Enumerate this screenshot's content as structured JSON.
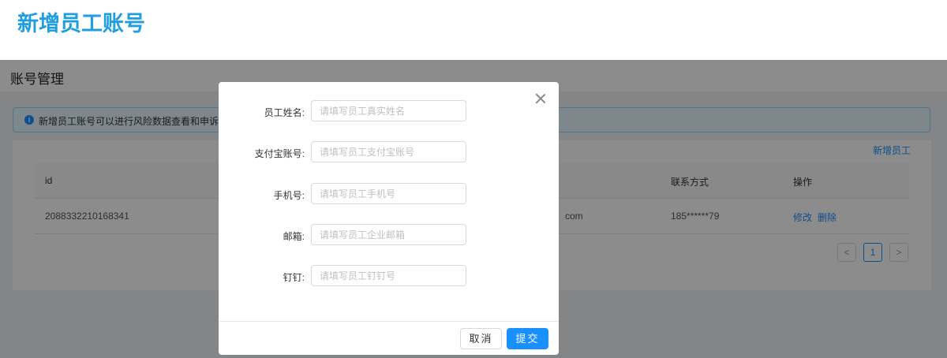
{
  "top_title": "新增员工账号",
  "page": {
    "title": "账号管理",
    "alert_text": "新增员工账号可以进行风险数据查看和申诉操作",
    "add_link": "新增员工",
    "table": {
      "headers": [
        "id",
        "联系方式",
        "操作"
      ],
      "row": {
        "id": "2088332210168341",
        "email_tail": "com",
        "phone": "185******79",
        "edit": "修改",
        "delete": "删除"
      }
    },
    "pagination": {
      "prev": "<",
      "current": "1",
      "next": ">"
    }
  },
  "modal": {
    "fields": [
      {
        "label": "员工姓名:",
        "placeholder": "请填写员工真实姓名"
      },
      {
        "label": "支付宝账号:",
        "placeholder": "请填写员工支付宝账号"
      },
      {
        "label": "手机号:",
        "placeholder": "请填写员工手机号"
      },
      {
        "label": "邮箱:",
        "placeholder": "请填写员工企业邮箱"
      },
      {
        "label": "钉钉:",
        "placeholder": "请填写员工钉钉号"
      }
    ],
    "cancel": "取消",
    "submit": "提交"
  }
}
